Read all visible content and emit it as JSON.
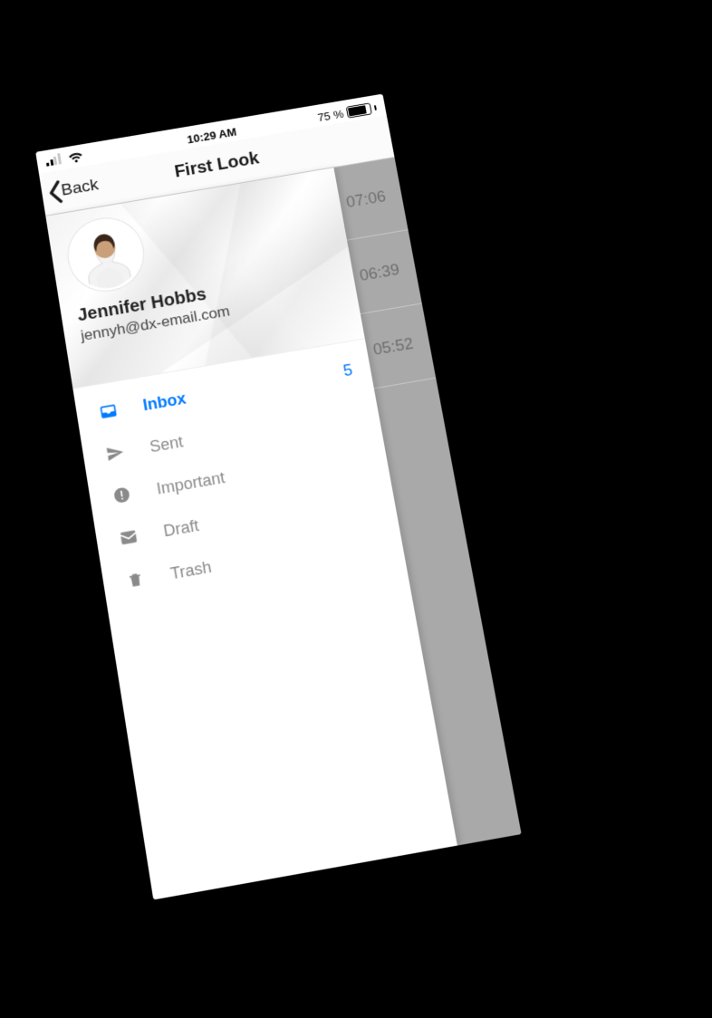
{
  "status": {
    "time": "10:29 AM",
    "battery_text": "75 %"
  },
  "nav": {
    "back_label": "Back",
    "title": "First Look"
  },
  "profile": {
    "name": "Jennifer Hobbs",
    "email": "jennyh@dx-email.com"
  },
  "folders": [
    {
      "icon": "inbox",
      "label": "Inbox",
      "badge": "5",
      "active": true
    },
    {
      "icon": "send",
      "label": "Sent",
      "badge": "",
      "active": false
    },
    {
      "icon": "important",
      "label": "Important",
      "badge": "",
      "active": false
    },
    {
      "icon": "draft",
      "label": "Draft",
      "badge": "",
      "active": false
    },
    {
      "icon": "trash",
      "label": "Trash",
      "badge": "",
      "active": false
    }
  ],
  "background_rows": [
    {
      "time": "07:06"
    },
    {
      "time": "06:39"
    },
    {
      "time": "05:52"
    }
  ],
  "accent": "#007aff"
}
